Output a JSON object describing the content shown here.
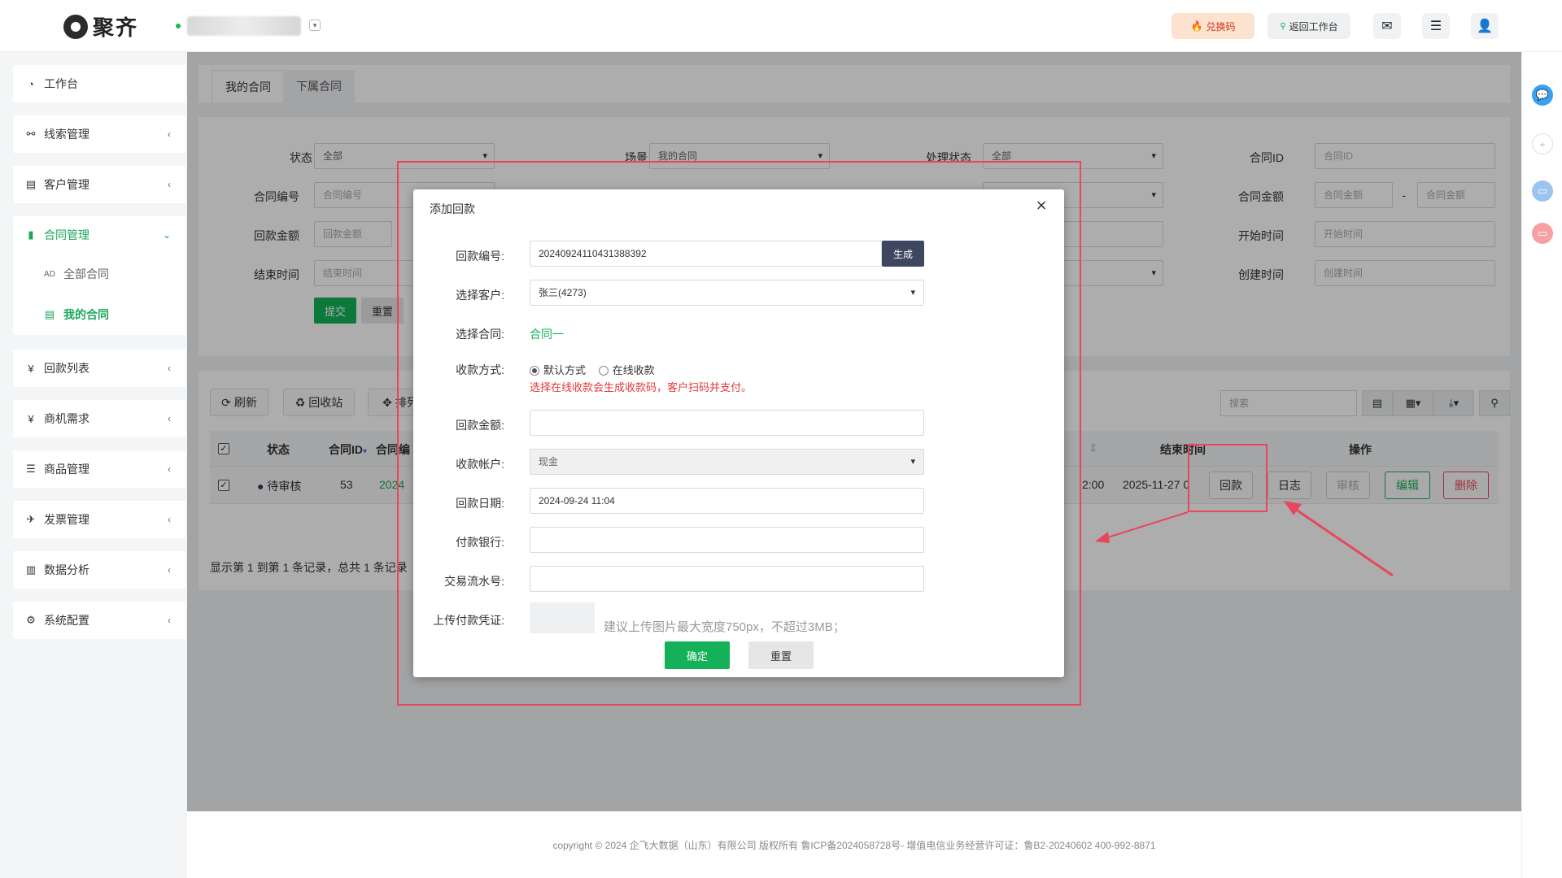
{
  "header": {
    "logo_text": "聚齐",
    "exchange_label": "兑换码",
    "return_label": "返回工作台",
    "icons": [
      "mail-icon",
      "menu-icon",
      "user-icon"
    ]
  },
  "sidebar": {
    "items": [
      {
        "label": "工作台",
        "icon": "dashboard-icon"
      },
      {
        "label": "线索管理",
        "icon": "link-icon"
      },
      {
        "label": "客户管理",
        "icon": "id-card-icon"
      },
      {
        "label": "合同管理",
        "icon": "bookmark-icon"
      },
      {
        "label": "回款列表",
        "icon": "yen-icon"
      },
      {
        "label": "商机需求",
        "icon": "yen-icon"
      },
      {
        "label": "商品管理",
        "icon": "list-icon"
      },
      {
        "label": "发票管理",
        "icon": "paper-plane-icon"
      },
      {
        "label": "数据分析",
        "icon": "bar-chart-icon"
      },
      {
        "label": "系统配置",
        "icon": "cogs-icon"
      }
    ],
    "sub_items": [
      {
        "label": "全部合同"
      },
      {
        "label": "我的合同"
      }
    ]
  },
  "tabs": [
    "我的合同",
    "下属合同"
  ],
  "filters": {
    "status_label": "状态",
    "status_value": "全部",
    "scene_label": "场景",
    "scene_value": "我的合同",
    "process_label": "处理状态",
    "process_value": "全部",
    "contract_id_label": "合同ID",
    "contract_id_placeholder": "合同ID",
    "contract_no_label": "合同编号",
    "contract_no_placeholder": "合同编号",
    "amount_label": "合同金额",
    "amount_placeholder": "合同金额",
    "range_sep": "-",
    "refund_amount_label": "回款金额",
    "refund_amount_placeholder": "回款金额",
    "start_time_label": "开始时间",
    "start_time_placeholder": "开始时间",
    "end_time_label": "结束时间",
    "end_time_placeholder": "结束时间",
    "created_time_label": "创建时间",
    "created_time_placeholder": "创建时间",
    "submit_label": "提交",
    "reset_label": "重置"
  },
  "toolbar": {
    "refresh_label": "刷新",
    "recycle_label": "回收站",
    "sort_label": "排列",
    "search_placeholder": "搜索"
  },
  "table": {
    "headers": {
      "status": "状态",
      "id": "合同ID",
      "no": "合同编",
      "end_time": "结束时间",
      "ops": "操作"
    },
    "row": {
      "status": "待审核",
      "id": "53",
      "no": "2024",
      "time_fragment": "2:00",
      "end_time": "2025-11-27 0"
    },
    "ops": {
      "refund": "回款",
      "log": "日志",
      "audit": "审核",
      "edit": "编辑",
      "delete": "删除"
    },
    "pager": "显示第 1 到第 1 条记录，总共 1 条记录"
  },
  "modal": {
    "title": "添加回款",
    "refund_no_label": "回款编号:",
    "refund_no_value": "20240924110431388392",
    "generate_label": "生成",
    "customer_label": "选择客户:",
    "customer_value": "张三(4273)",
    "contract_label": "选择合同:",
    "contract_value": "合同一",
    "pay_method_label": "收款方式:",
    "pay_default": "默认方式",
    "pay_online": "在线收款",
    "pay_hint": "选择在线收款会生成收款码，客户扫码并支付。",
    "amount_label": "回款金额:",
    "account_label": "收款帐户:",
    "account_value": "现金",
    "date_label": "回款日期:",
    "date_value": "2024-09-24 11:04",
    "bank_label": "付款银行:",
    "serial_label": "交易流水号:",
    "upload_label": "上传付款凭证:",
    "upload_hint": "建议上传图片最大宽度750px，不超过3MB；",
    "confirm_label": "确定",
    "reset_label": "重置"
  },
  "footer": {
    "text": "copyright © 2024 企飞大数据（山东）有限公司 版权所有   鲁ICP备2024058728号-   增值电信业务经营许可证：鲁B2-20240602  400-992-8871"
  },
  "colors": {
    "accent": "#14b159",
    "danger": "#e8465b",
    "annotation": "#e8465b"
  }
}
